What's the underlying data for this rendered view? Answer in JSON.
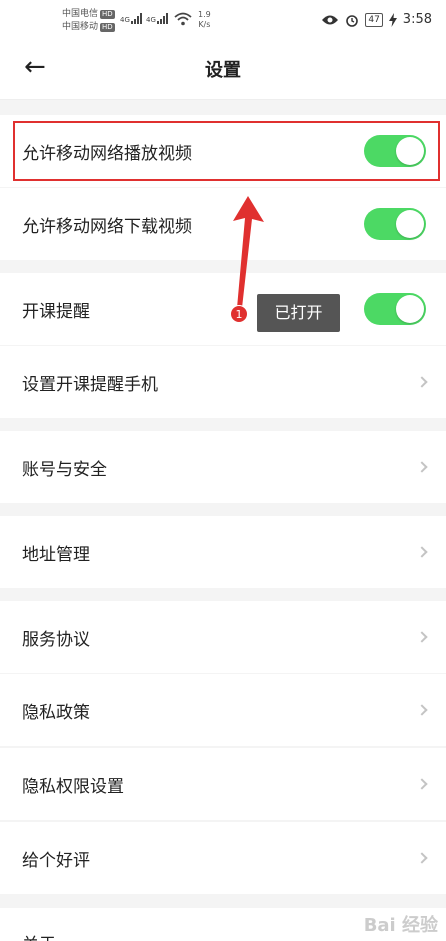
{
  "status_bar": {
    "carrier1": "中国电信",
    "carrier2": "中国移动",
    "hd": "HD",
    "net": "4G",
    "speed_value": "1.9",
    "speed_unit": "K/s",
    "battery": "47",
    "time": "3:58"
  },
  "header": {
    "back_icon": "←",
    "title": "设置"
  },
  "sections": [
    {
      "label": "允许移动网络播放视频",
      "control": "toggle",
      "on": true
    },
    {
      "label": "允许移动网络下载视频",
      "control": "toggle",
      "on": true
    },
    {
      "label": "开课提醒",
      "control": "toggle",
      "on": true
    },
    {
      "label": "设置开课提醒手机",
      "control": "chevron"
    },
    {
      "label": "账号与安全",
      "control": "chevron"
    },
    {
      "label": "地址管理",
      "control": "chevron"
    },
    {
      "label": "服务协议",
      "control": "chevron"
    },
    {
      "label": "隐私政策",
      "control": "chevron"
    },
    {
      "label": "隐私权限设置",
      "control": "chevron"
    },
    {
      "label": "给个好评",
      "control": "chevron"
    },
    {
      "label": "关于",
      "control": "chevron"
    }
  ],
  "annotation": {
    "badge": "1",
    "text": "已打开",
    "color": "#e0302f"
  },
  "colors": {
    "toggle_on": "#4cd964",
    "accent": "#e0302f"
  },
  "watermark": "Bai 经验"
}
